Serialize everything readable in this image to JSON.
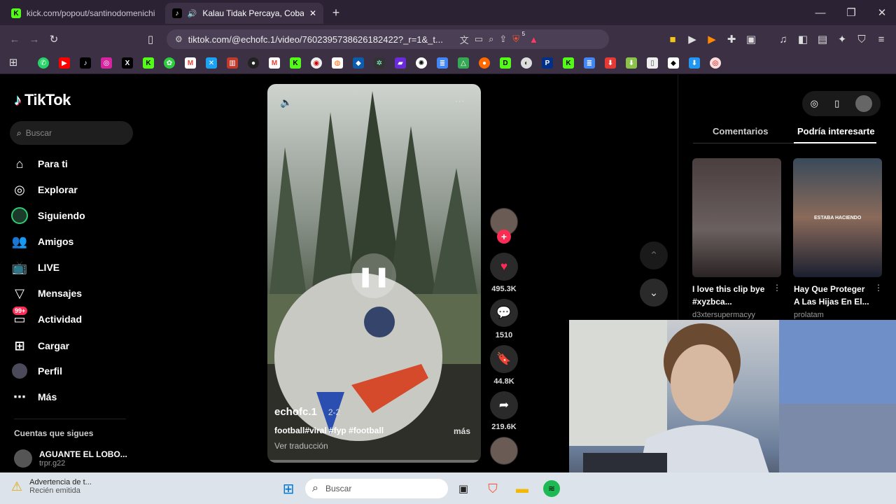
{
  "browser": {
    "tabs": [
      {
        "label": "kick.com/popout/santinodomenichin",
        "icon": "kick-icon"
      },
      {
        "label": "Kalau Tidak Percaya, Coba De",
        "icon": "tiktok-icon"
      }
    ],
    "url": "tiktok.com/@echofc.1/video/7602395738626182422?_r=1&_t...",
    "shield_badge": "5"
  },
  "sidebar": {
    "logo": "TikTok",
    "search_placeholder": "Buscar",
    "items": [
      {
        "label": "Para ti",
        "icon": "home-icon"
      },
      {
        "label": "Explorar",
        "icon": "compass-icon"
      },
      {
        "label": "Siguiendo",
        "icon": "following-icon"
      },
      {
        "label": "Amigos",
        "icon": "friends-icon"
      },
      {
        "label": "LIVE",
        "icon": "live-icon"
      },
      {
        "label": "Mensajes",
        "icon": "messages-icon"
      },
      {
        "label": "Actividad",
        "icon": "activity-icon",
        "badge": "99+"
      },
      {
        "label": "Cargar",
        "icon": "upload-icon"
      },
      {
        "label": "Perfil",
        "icon": "profile-icon"
      },
      {
        "label": "Más",
        "icon": "more-icon"
      }
    ],
    "following_heading": "Cuentas que sigues",
    "followed": {
      "name": "AGUANTE EL LOBO...",
      "handle": "trpr.g22"
    }
  },
  "video": {
    "author": "echofc.1",
    "date": "2-2",
    "caption": "football#viral #fyp #football",
    "more": "más",
    "translate": "Ver traducción"
  },
  "actions": {
    "likes": "495.3K",
    "comments": "1510",
    "saves": "44.8K",
    "shares": "219.6K"
  },
  "right_panel": {
    "tabs": [
      "Comentarios",
      "Podría interesarte"
    ],
    "cards": [
      {
        "title": "I love this clip bye #xyzbca...",
        "author": "d3xtersupermacyy"
      },
      {
        "title": "Hay Que Proteger A Las Hijas En El...",
        "author": "prolatam",
        "overlay": "ESTABA HACIENDO"
      }
    ]
  },
  "taskbar": {
    "notification_title": "Advertencia de t...",
    "notification_sub": "Recién emitida",
    "search_placeholder": "Buscar"
  },
  "colors": {
    "brand": "#fe2c55",
    "browser_bg": "#3b3044",
    "page_bg": "#000000"
  }
}
